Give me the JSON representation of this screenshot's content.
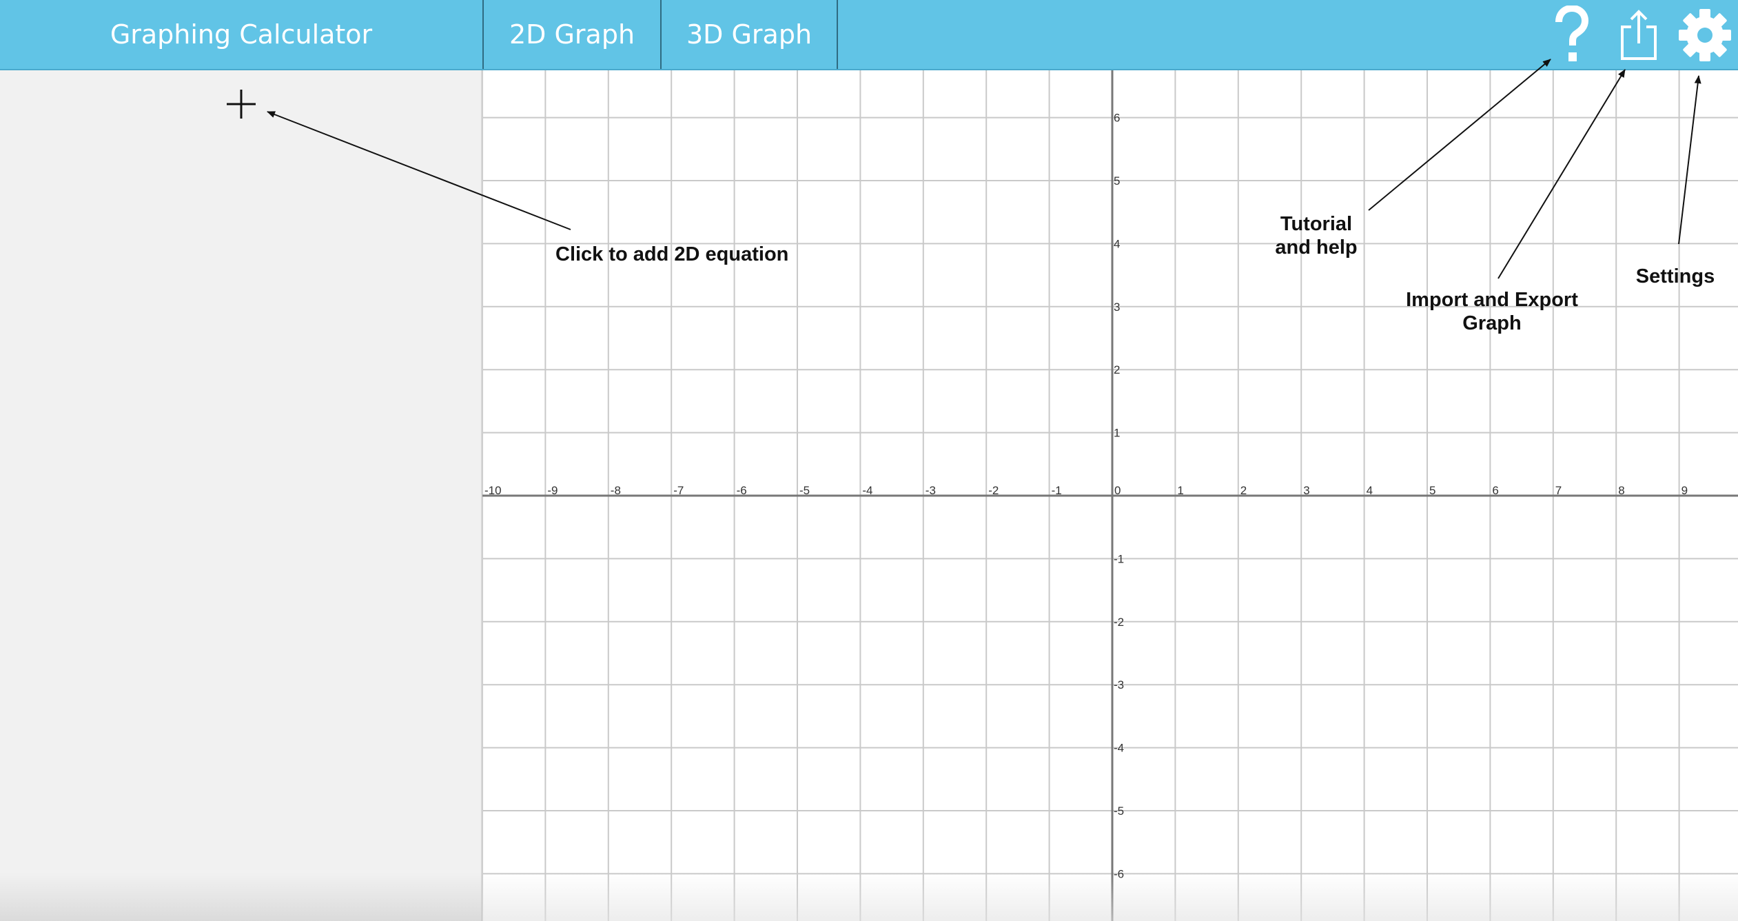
{
  "app": {
    "title": "Graphing Calculator",
    "accent_color": "#61c4e6"
  },
  "tabs": [
    {
      "label": "2D Graph"
    },
    {
      "label": "3D Graph"
    }
  ],
  "toolbar": {
    "help_icon": "question-mark-icon",
    "share_icon": "share-export-icon",
    "settings_icon": "gear-icon"
  },
  "sidebar": {
    "add_icon": "plus-icon"
  },
  "graph": {
    "x_ticks": [
      "-10",
      "-9",
      "-8",
      "-7",
      "-6",
      "-5",
      "-4",
      "-3",
      "-2",
      "-1",
      "0",
      "1",
      "2",
      "3",
      "4",
      "5",
      "6",
      "7",
      "8",
      "9"
    ],
    "y_ticks_pos": [
      "6",
      "5",
      "4",
      "3",
      "2",
      "1"
    ],
    "y_ticks_neg": [
      "-1",
      "-2",
      "-3",
      "-4",
      "-5",
      "-6"
    ],
    "x_range": [
      -10,
      10
    ],
    "y_range": [
      -6.7,
      6.7
    ],
    "grid": true
  },
  "annotations": {
    "add_equation": "Click to add 2D equation",
    "help_line1": "Tutorial",
    "help_line2": "and help",
    "io_line1": "Import and Export",
    "io_line2": "Graph",
    "settings": "Settings"
  }
}
